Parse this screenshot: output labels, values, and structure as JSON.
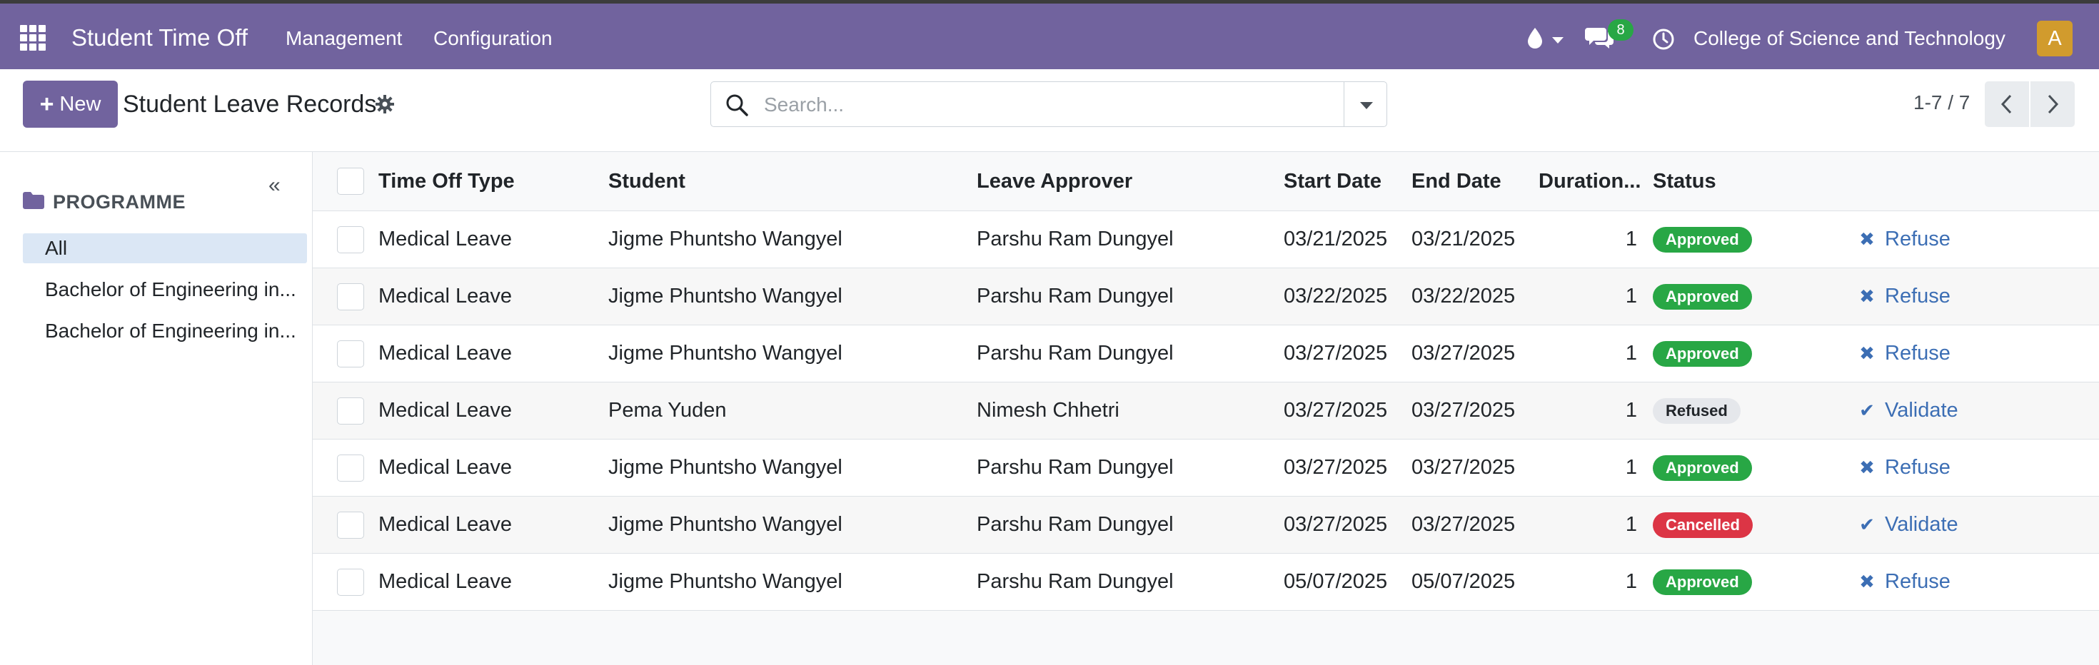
{
  "app": {
    "name": "Student Time Off",
    "menus": [
      "Management",
      "Configuration"
    ],
    "notifications": "8",
    "company": "College of Science and Technology",
    "user_initial": "A",
    "accent": "#71639e"
  },
  "controls": {
    "new_label": "New",
    "title": "Student Leave Records",
    "search_placeholder": "Search...",
    "pager": "1-7 / 7"
  },
  "sidebar": {
    "heading": "PROGRAMME",
    "items": [
      {
        "label": "All",
        "active": true
      },
      {
        "label": "Bachelor of Engineering in..."
      },
      {
        "label": "Bachelor of Engineering in..."
      }
    ]
  },
  "table": {
    "columns": [
      "Time Off Type",
      "Student",
      "Leave Approver",
      "Start Date",
      "End Date",
      "Duration...",
      "Status"
    ],
    "rows": [
      {
        "type": "Medical Leave",
        "student": "Jigme Phuntsho Wangyel",
        "approver": "Parshu Ram Dungyel",
        "start": "03/21/2025",
        "end": "03/21/2025",
        "duration": "1",
        "status": "Approved",
        "status_kind": "approved",
        "action": "Refuse",
        "action_icon": "close-icon"
      },
      {
        "type": "Medical Leave",
        "student": "Jigme Phuntsho Wangyel",
        "approver": "Parshu Ram Dungyel",
        "start": "03/22/2025",
        "end": "03/22/2025",
        "duration": "1",
        "status": "Approved",
        "status_kind": "approved",
        "action": "Refuse",
        "action_icon": "close-icon"
      },
      {
        "type": "Medical Leave",
        "student": "Jigme Phuntsho Wangyel",
        "approver": "Parshu Ram Dungyel",
        "start": "03/27/2025",
        "end": "03/27/2025",
        "duration": "1",
        "status": "Approved",
        "status_kind": "approved",
        "action": "Refuse",
        "action_icon": "close-icon"
      },
      {
        "type": "Medical Leave",
        "student": "Pema Yuden",
        "approver": "Nimesh Chhetri",
        "start": "03/27/2025",
        "end": "03/27/2025",
        "duration": "1",
        "status": "Refused",
        "status_kind": "refused",
        "action": "Validate",
        "action_icon": "check-icon"
      },
      {
        "type": "Medical Leave",
        "student": "Jigme Phuntsho Wangyel",
        "approver": "Parshu Ram Dungyel",
        "start": "03/27/2025",
        "end": "03/27/2025",
        "duration": "1",
        "status": "Approved",
        "status_kind": "approved",
        "action": "Refuse",
        "action_icon": "close-icon"
      },
      {
        "type": "Medical Leave",
        "student": "Jigme Phuntsho Wangyel",
        "approver": "Parshu Ram Dungyel",
        "start": "03/27/2025",
        "end": "03/27/2025",
        "duration": "1",
        "status": "Cancelled",
        "status_kind": "cancelled",
        "action": "Validate",
        "action_icon": "check-icon"
      },
      {
        "type": "Medical Leave",
        "student": "Jigme Phuntsho Wangyel",
        "approver": "Parshu Ram Dungyel",
        "start": "05/07/2025",
        "end": "05/07/2025",
        "duration": "1",
        "status": "Approved",
        "status_kind": "approved",
        "action": "Refuse",
        "action_icon": "close-icon"
      }
    ]
  }
}
